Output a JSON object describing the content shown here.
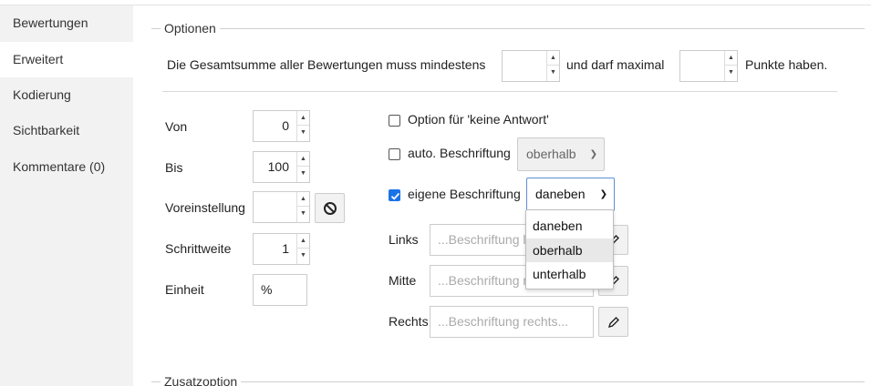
{
  "sidebar": {
    "items": [
      {
        "label": "Bewertungen",
        "active": false
      },
      {
        "label": "Erweitert",
        "active": true
      },
      {
        "label": "Kodierung",
        "active": false
      },
      {
        "label": "Sichtbarkeit",
        "active": false
      },
      {
        "label": "Kommentare (0)",
        "active": false
      }
    ]
  },
  "options": {
    "legend": "Optionen",
    "sum_text_before": "Die Gesamtsumme aller Bewertungen muss mindestens",
    "sum_text_middle": "und darf maximal",
    "sum_text_after": "Punkte haben.",
    "sum_min_value": "",
    "sum_max_value": ""
  },
  "fields": {
    "von_label": "Von",
    "von_value": "0",
    "bis_label": "Bis",
    "bis_value": "100",
    "voreinstellung_label": "Voreinstellung",
    "voreinstellung_value": "",
    "schrittweite_label": "Schrittweite",
    "schrittweite_value": "1",
    "einheit_label": "Einheit",
    "einheit_value": "%"
  },
  "right": {
    "keine_antwort_label": "Option für 'keine Antwort'",
    "keine_antwort_checked": false,
    "auto_label": "auto. Beschriftung",
    "auto_checked": false,
    "auto_select_value": "oberhalb",
    "eigene_label": "eigene Beschriftung",
    "eigene_checked": true,
    "eigene_select_value": "daneben",
    "dropdown_options": [
      "daneben",
      "oberhalb",
      "unterhalb"
    ],
    "dropdown_hovered": "oberhalb",
    "links_label": "Links",
    "links_placeholder": "...Beschriftung li",
    "mitte_label": "Mitte",
    "mitte_placeholder": "...Beschriftung m",
    "rechts_label": "Rechts",
    "rechts_placeholder": "...Beschriftung rechts..."
  },
  "zusatz": {
    "legend": "Zusatzoption"
  },
  "colors": {
    "accent": "#1a73e8",
    "sidebar_bg": "#f2f2f2",
    "border": "#cccccc"
  },
  "icons": {
    "reset": "ban-icon",
    "edit": "pencil-icon"
  }
}
